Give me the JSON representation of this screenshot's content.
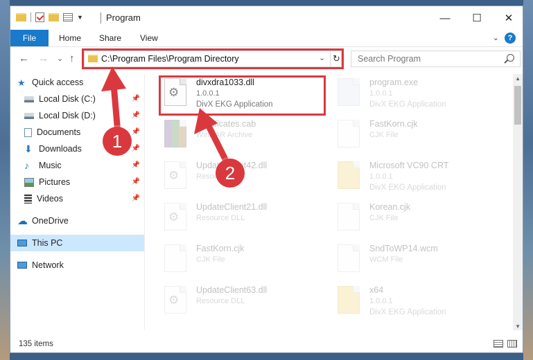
{
  "window": {
    "title": "Program",
    "controls": {
      "minimize": "—",
      "maximize": "☐",
      "close": "✕"
    }
  },
  "ribbon": {
    "tabs": [
      "File",
      "Home",
      "Share",
      "View"
    ],
    "help": "?",
    "expand": "⌄"
  },
  "navbar": {
    "back": "←",
    "forward": "→",
    "recent": "⌄",
    "up": "↑",
    "address": "C:\\Program Files\\Program Directory",
    "address_dropdown": "⌄",
    "refresh": "↻",
    "search_placeholder": "Search Program"
  },
  "sidebar": {
    "items": [
      {
        "label": "Quick access",
        "icon": "star-icon",
        "pinned": false
      },
      {
        "label": "Local Disk (C:)",
        "icon": "drive-icon",
        "pinned": true
      },
      {
        "label": "Local Disk (D:)",
        "icon": "drive-icon",
        "pinned": true
      },
      {
        "label": "Documents",
        "icon": "documents-icon",
        "pinned": true
      },
      {
        "label": "Downloads",
        "icon": "download-icon",
        "pinned": true
      },
      {
        "label": "Music",
        "icon": "music-icon",
        "pinned": true
      },
      {
        "label": "Pictures",
        "icon": "pictures-icon",
        "pinned": true
      },
      {
        "label": "Videos",
        "icon": "videos-icon",
        "pinned": true
      },
      {
        "label": "OneDrive",
        "icon": "cloud-icon",
        "pinned": false
      },
      {
        "label": "This PC",
        "icon": "computer-icon",
        "pinned": false,
        "selected": true
      },
      {
        "label": "Network",
        "icon": "network-icon",
        "pinned": false
      }
    ],
    "pin_glyph": "📌"
  },
  "files": [
    {
      "name": "divxdra1033.dll",
      "line1": "1.0.0.1",
      "line2": "DivX EKG Application",
      "icon": "dll-gear-icon",
      "highlight": true
    },
    {
      "name": "program.exe",
      "line1": "1.0.0.1",
      "line2": "DivX EKG Application",
      "icon": "exe-icon"
    },
    {
      "name": "Certificates.cab",
      "line1": "WinRAR Archive",
      "line2": "",
      "icon": "rar-icon"
    },
    {
      "name": "FastKorn.cjk",
      "line1": "CJK File",
      "line2": "",
      "icon": "file-icon"
    },
    {
      "name": "UpdateClient42.dll",
      "line1": "Resource DLL",
      "line2": "",
      "icon": "dll-gear-icon"
    },
    {
      "name": "Microsoft VC90 CRT",
      "line1": "1.0.0.1",
      "line2": "DivX EKG Application",
      "icon": "folder-icon"
    },
    {
      "name": "UpdateClient21.dll",
      "line1": "Resource DLL",
      "line2": "",
      "icon": "dll-gear-icon"
    },
    {
      "name": "Korean.cjk",
      "line1": "CJK File",
      "line2": "",
      "icon": "file-icon"
    },
    {
      "name": "FastKorn.cjk",
      "line1": "CJK File",
      "line2": "",
      "icon": "file-icon"
    },
    {
      "name": "SndToWP14.wcm",
      "line1": "WCM File",
      "line2": "",
      "icon": "file-icon"
    },
    {
      "name": "UpdateClient63.dll",
      "line1": "Resource DLL",
      "line2": "",
      "icon": "dll-gear-icon"
    },
    {
      "name": "x64",
      "line1": "1.0.0.1",
      "line2": "DivX EKG Application",
      "icon": "folder-icon"
    }
  ],
  "badges": [
    "1",
    "2"
  ],
  "status": {
    "item_count": "135 items"
  },
  "colors": {
    "accent": "#1979ca",
    "highlight": "#d9393e",
    "selected": "#cce8ff"
  }
}
